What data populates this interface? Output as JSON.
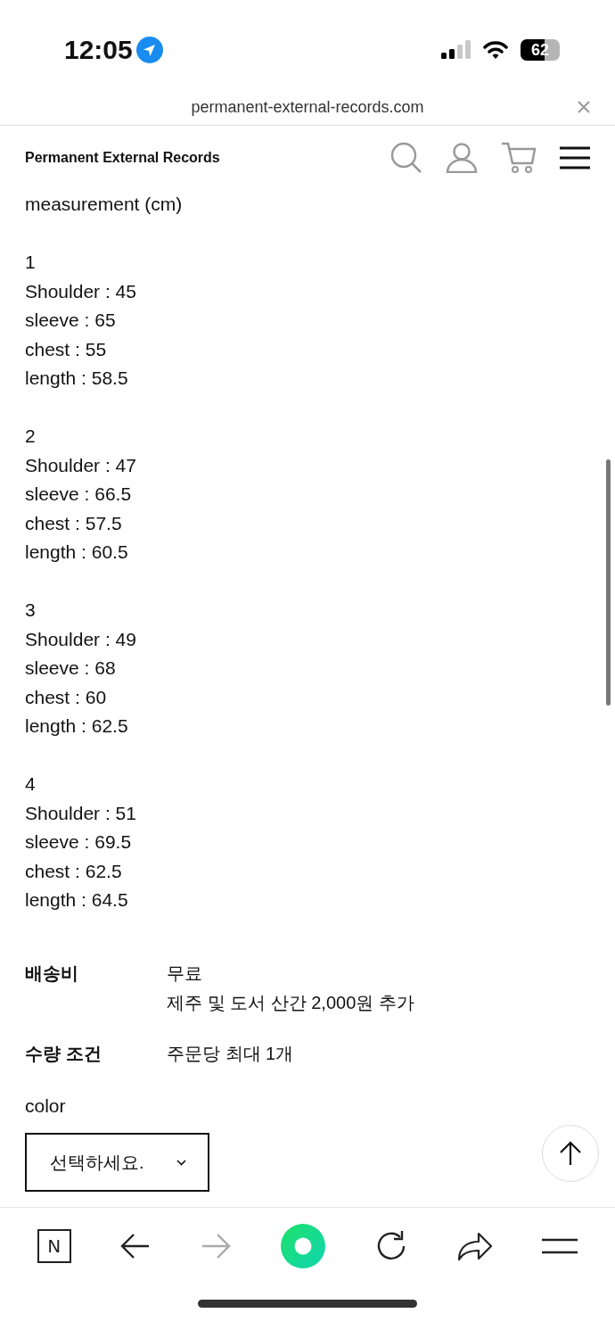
{
  "status_bar": {
    "time": "12:05",
    "battery": "62"
  },
  "browser": {
    "url": "permanent-external-records.com"
  },
  "header": {
    "title": "Permanent External Records"
  },
  "content": {
    "heading": "measurement (cm)",
    "sizes": [
      {
        "number": "1",
        "lines": [
          "Shoulder : 45",
          "sleeve : 65",
          "chest : 55",
          "length : 58.5"
        ]
      },
      {
        "number": "2",
        "lines": [
          "Shoulder : 47",
          "sleeve : 66.5",
          "chest : 57.5",
          "length : 60.5"
        ]
      },
      {
        "number": "3",
        "lines": [
          "Shoulder : 49",
          "sleeve : 68",
          "chest : 60",
          "length : 62.5"
        ]
      },
      {
        "number": "4",
        "lines": [
          "Shoulder : 51",
          "sleeve : 69.5",
          "chest : 62.5",
          "length : 64.5"
        ]
      }
    ],
    "info": [
      {
        "label": "배송비",
        "values": [
          "무료",
          "제주 및 도서 산간 2,000원 추가"
        ]
      },
      {
        "label": "수량 조건",
        "values": [
          "주문당 최대 1개"
        ]
      }
    ],
    "option": {
      "label": "color",
      "select": "선택하세요."
    }
  },
  "toolbar": [
    {
      "kind": "tabs",
      "text": "N",
      "disabled": false
    },
    {
      "kind": "back",
      "disabled": false
    },
    {
      "kind": "forward",
      "disabled": true
    },
    {
      "kind": "home",
      "disabled": false
    },
    {
      "kind": "reload",
      "disabled": false
    },
    {
      "kind": "share",
      "disabled": false
    },
    {
      "kind": "menu",
      "disabled": false
    }
  ]
}
